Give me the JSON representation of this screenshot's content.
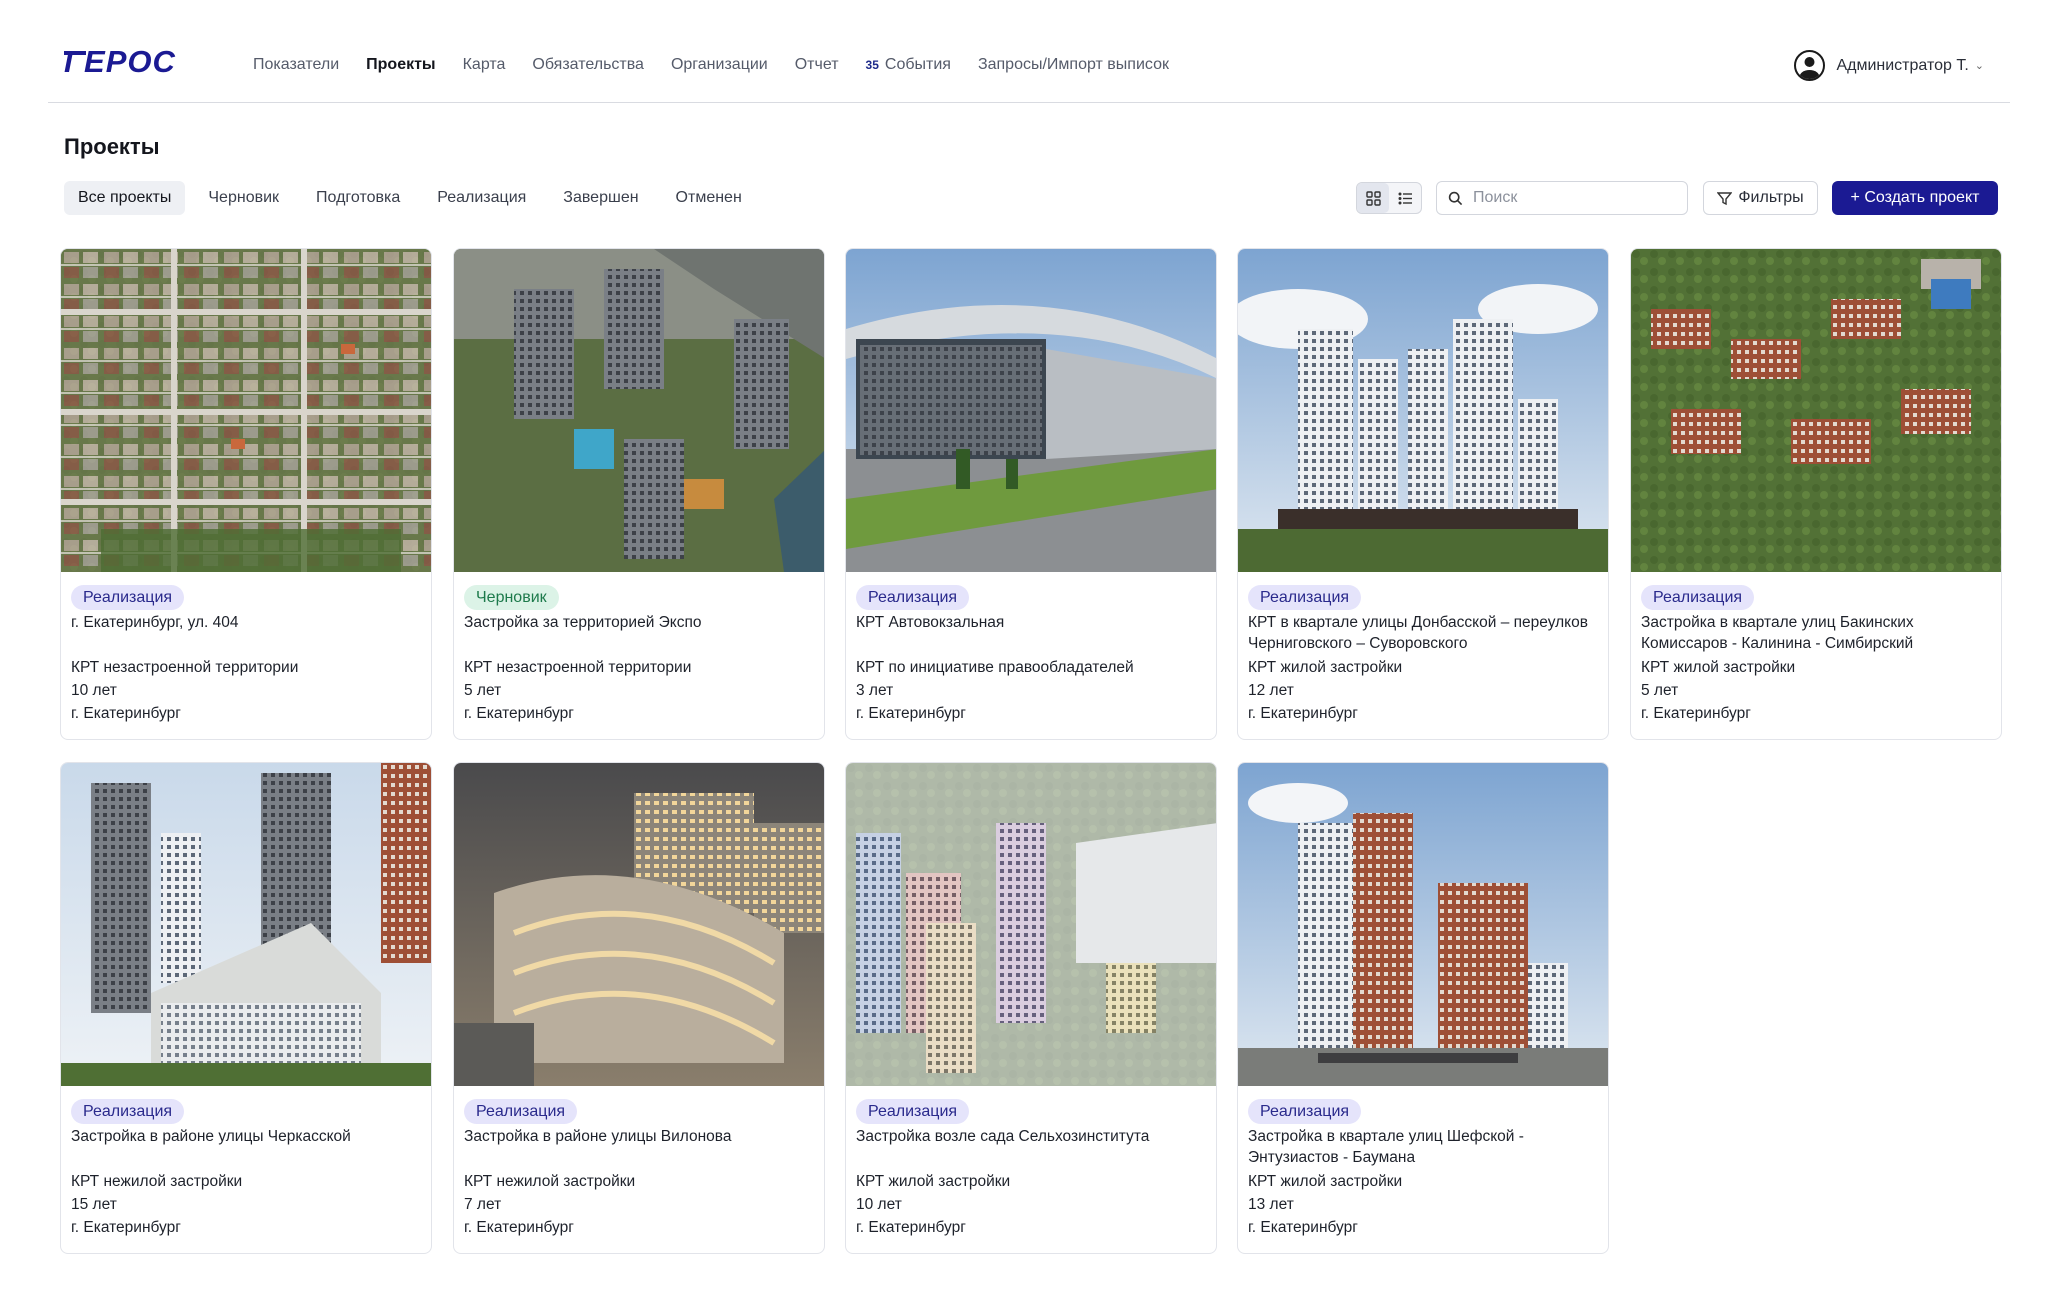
{
  "app": {
    "logo_text": "ГЕРОС",
    "nav": [
      {
        "label": "Показатели",
        "active": false
      },
      {
        "label": "Проекты",
        "active": true
      },
      {
        "label": "Карта",
        "active": false
      },
      {
        "label": "Обязательства",
        "active": false
      },
      {
        "label": "Организации",
        "active": false
      },
      {
        "label": "Отчет",
        "active": false
      },
      {
        "label": "События",
        "badge": "35",
        "active": false
      },
      {
        "label": "Запросы/Импорт выписок",
        "active": false
      }
    ],
    "user": {
      "name": "Администратор Т."
    }
  },
  "page": {
    "title": "Проекты",
    "tabs": [
      {
        "label": "Все проекты",
        "active": true
      },
      {
        "label": "Черновик",
        "active": false
      },
      {
        "label": "Подготовка",
        "active": false
      },
      {
        "label": "Реализация",
        "active": false
      },
      {
        "label": "Завершен",
        "active": false
      },
      {
        "label": "Отменен",
        "active": false
      }
    ],
    "search_placeholder": "Поиск",
    "filters_label": "Фильтры",
    "create_label": "+ Создать проект",
    "accent_color": "#1b1a93"
  },
  "projects": [
    {
      "status": "Реализация",
      "title": "г. Екатеринбург, ул. 404",
      "type": "КРТ незастроенной территории",
      "term": "10 лет",
      "city": "г. Екатеринбург"
    },
    {
      "status": "Черновик",
      "title": "Застройка за территорией Экспо",
      "type": "КРТ незастроенной территории",
      "term": "5 лет",
      "city": "г. Екатеринбург"
    },
    {
      "status": "Реализация",
      "title": "КРТ Автовокзальная",
      "type": "КРТ по инициативе правообладателей",
      "term": "3 лет",
      "city": "г. Екатеринбург"
    },
    {
      "status": "Реализация",
      "title": "КРТ в квартале улицы Донбасской – переулков Черниговского – Суворовского",
      "type": "КРТ жилой застройки",
      "term": "12 лет",
      "city": "г. Екатеринбург"
    },
    {
      "status": "Реализация",
      "title": "Застройка в квартале улиц Бакинских Комиссаров - Калинина - Симбирский",
      "type": "КРТ жилой застройки",
      "term": "5 лет",
      "city": "г. Екатеринбург"
    },
    {
      "status": "Реализация",
      "title": "Застройка в районе улицы Черкасской",
      "type": "КРТ нежилой застройки",
      "term": "15 лет",
      "city": "г. Екатеринбург"
    },
    {
      "status": "Реализация",
      "title": "Застройка в районе улицы Вилонова",
      "type": "КРТ нежилой застройки",
      "term": "7 лет",
      "city": "г. Екатеринбург"
    },
    {
      "status": "Реализация",
      "title": "Застройка возле сада Сельхозинститута",
      "type": "КРТ жилой застройки",
      "term": "10 лет",
      "city": "г. Екатеринбург"
    },
    {
      "status": "Реализация",
      "title": "Застройка в квартале улиц Шефской - Энтузиастов - Баумана",
      "type": "КРТ жилой застройки",
      "term": "13 лет",
      "city": "г. Екатеринбург"
    }
  ]
}
